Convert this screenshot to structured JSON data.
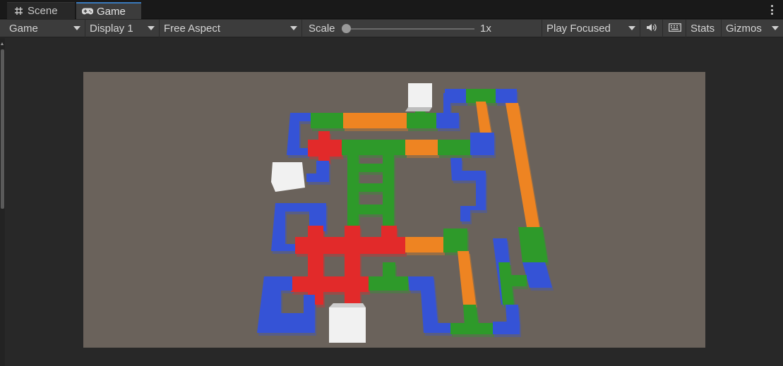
{
  "tabs": [
    {
      "label": "Scene",
      "icon": "grid-icon"
    },
    {
      "label": "Game",
      "icon": "gamepad-icon",
      "active": true
    }
  ],
  "toolbar": {
    "view_mode": "Game",
    "display": "Display 1",
    "aspect": "Free Aspect",
    "scale_label": "Scale",
    "scale_value": "1x",
    "play_mode": "Play Focused",
    "stats_label": "Stats",
    "gizmos_label": "Gizmos"
  },
  "viewport": {
    "background": "#6a625b",
    "colors": {
      "blue": "#3552d6",
      "green": "#2f9a2b",
      "orange": "#ee8424",
      "red": "#e2292b",
      "white": "#f1f1f1"
    }
  }
}
